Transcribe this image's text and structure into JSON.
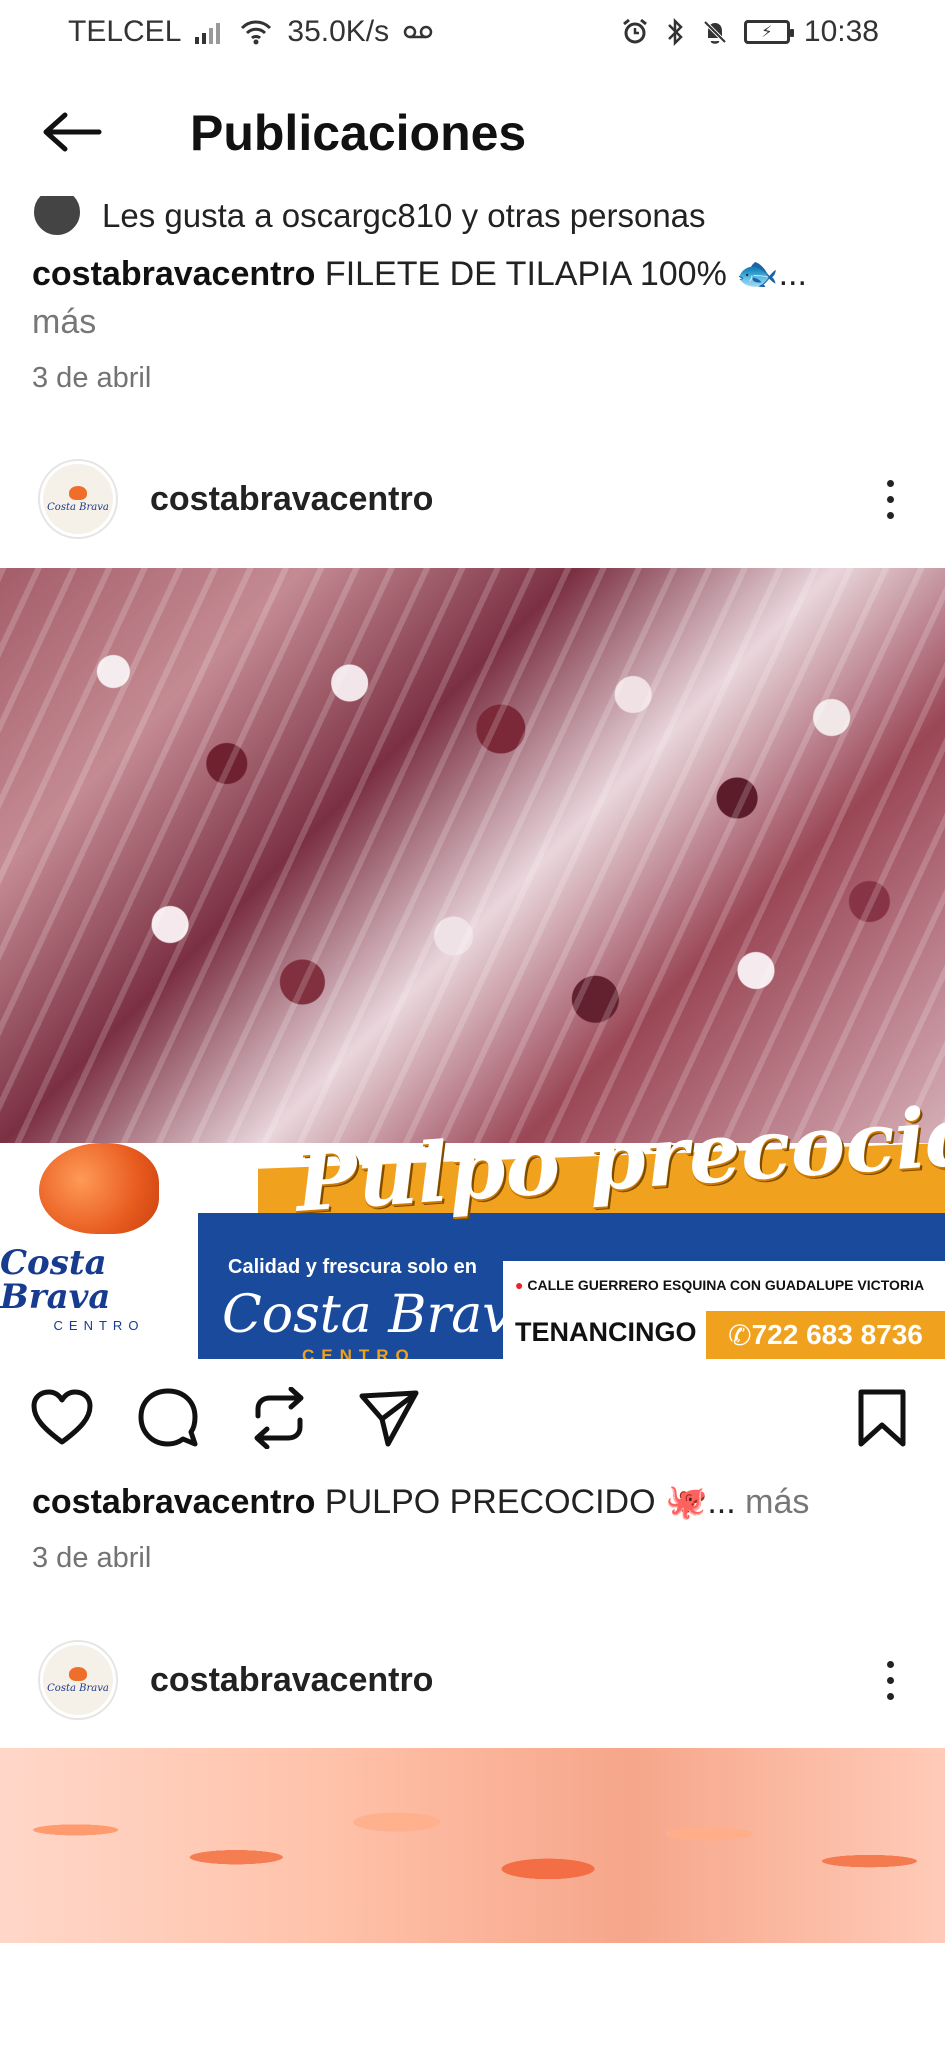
{
  "status_bar": {
    "carrier": "TELCEL",
    "speed": "35.0K/s",
    "time": "10:38"
  },
  "header": {
    "title": "Publicaciones"
  },
  "posts": [
    {
      "likes_text": "Les gusta a oscargc810 y otras personas",
      "caption_user": "costabravacentro",
      "caption_text": "FILETE DE TILAPIA 100% 🐟...",
      "more": "más",
      "date": "3 de abril"
    },
    {
      "username": "costabravacentro",
      "banner": {
        "title": "Pulpo precocido",
        "tagline": "Calidad y frescura solo en",
        "store": "Costa Brava",
        "store_sub": "CENTRO",
        "brand_name": "Costa Brava",
        "brand_sub": "CENTRO",
        "address": "CALLE GUERRERO ESQUINA CON GUADALUPE VICTORIA",
        "city": "TENANCINGO",
        "phone": "722 683 8736"
      },
      "caption_user": "costabravacentro",
      "caption_text": "PULPO PRECOCIDO 🐙...",
      "more": "más",
      "date": "3 de abril"
    },
    {
      "username": "costabravacentro"
    }
  ],
  "icons": {
    "back": "arrow-left",
    "like": "heart-outline",
    "comment": "comment-bubble",
    "repost": "repost-arrows",
    "share": "paper-plane",
    "save": "bookmark-outline",
    "more": "vertical-ellipsis"
  }
}
